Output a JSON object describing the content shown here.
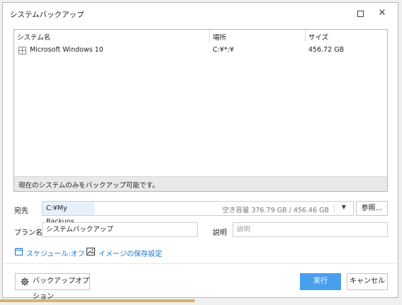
{
  "window": {
    "title": "システムバックアップ",
    "maximize_icon": "maximize-icon",
    "close_icon": "close-icon",
    "close_glyph": "✕"
  },
  "table": {
    "columns": [
      "システム名",
      "場所",
      "サイズ"
    ],
    "rows": [
      {
        "icon": "windows-icon",
        "name": "Microsoft Windows 10",
        "location": "C:¥*:¥",
        "size": "456.72 GB"
      }
    ],
    "footer_note": "現在のシステムのみをバックアップ可能です。"
  },
  "destination": {
    "label": "宛先",
    "path": "C:¥My Backups",
    "free_space": "空き容量 376.79 GB / 456.46 GB",
    "dropdown_glyph": "▼",
    "browse_label": "参照…"
  },
  "plan": {
    "label": "プラン名",
    "value": "システムバックアップ"
  },
  "description": {
    "label": "説明",
    "placeholder": "説明"
  },
  "links": {
    "schedule": "スケジュール:オフ",
    "image_settings": "イメージの保存設定"
  },
  "buttons": {
    "options": "バックアップオプション",
    "run": "実行",
    "cancel": "キャンセル"
  },
  "colors": {
    "accent": "#4a9fed",
    "link": "#1a73c8",
    "path_highlight": "#e8f1fb"
  }
}
